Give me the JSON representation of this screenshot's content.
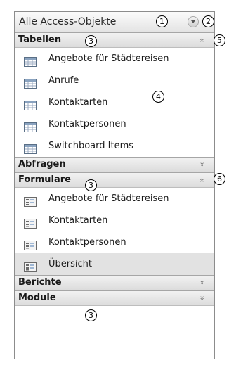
{
  "nav_pane": {
    "title": "Alle Access-Objekte",
    "groups": [
      {
        "label": "Tabellen",
        "expanded": true,
        "chevron": "»",
        "items": [
          {
            "label": "Angebote für Städtereisen",
            "icon": "table-icon"
          },
          {
            "label": "Anrufe",
            "icon": "table-icon"
          },
          {
            "label": "Kontaktarten",
            "icon": "table-icon"
          },
          {
            "label": "Kontaktpersonen",
            "icon": "table-icon"
          },
          {
            "label": "Switchboard Items",
            "icon": "table-icon"
          }
        ]
      },
      {
        "label": "Abfragen",
        "expanded": false,
        "chevron": "»",
        "items": []
      },
      {
        "label": "Formulare",
        "expanded": true,
        "chevron": "»",
        "items": [
          {
            "label": "Angebote für Städtereisen",
            "icon": "form-icon"
          },
          {
            "label": "Kontaktarten",
            "icon": "form-icon"
          },
          {
            "label": "Kontaktpersonen",
            "icon": "form-icon"
          },
          {
            "label": "Übersicht",
            "icon": "form-icon",
            "selected": true
          }
        ]
      },
      {
        "label": "Berichte",
        "expanded": false,
        "chevron": "»",
        "items": []
      },
      {
        "label": "Module",
        "expanded": false,
        "chevron": "»",
        "items": []
      }
    ]
  },
  "callouts": {
    "c1": "1",
    "c2": "2",
    "c3": "3",
    "c4": "4",
    "c5": "5",
    "c6": "6"
  }
}
